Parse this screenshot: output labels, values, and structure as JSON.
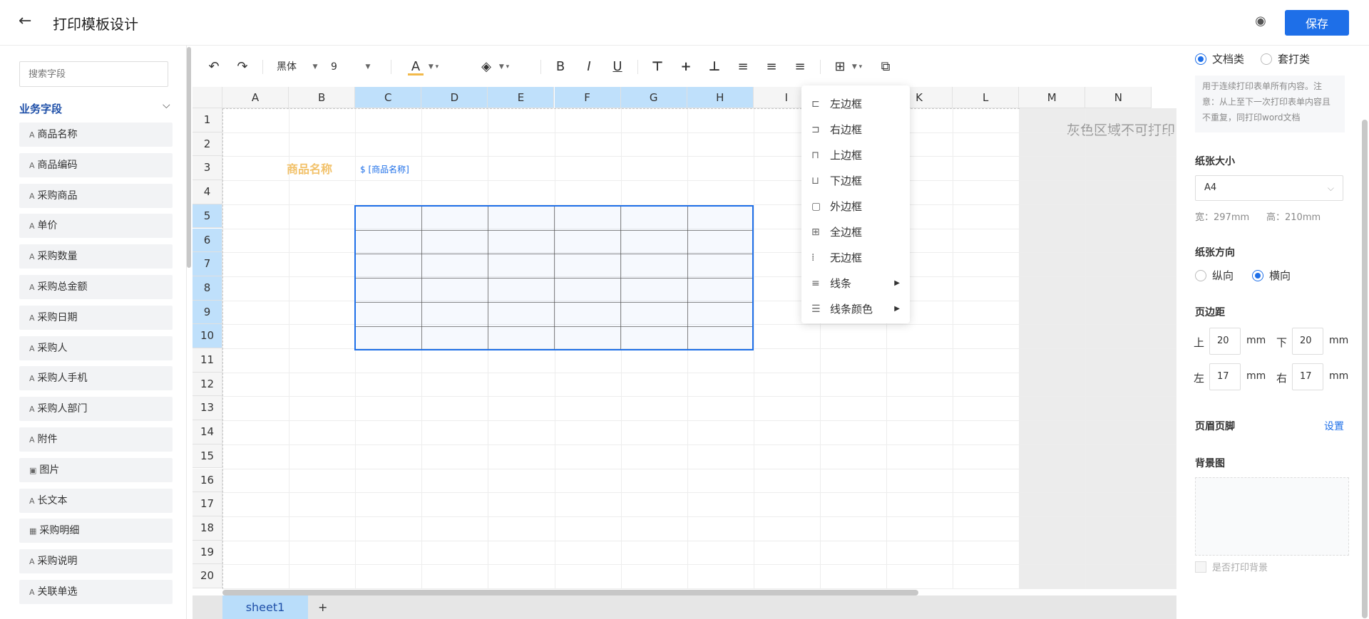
{
  "header": {
    "title": "打印模板设计",
    "save_label": "保存",
    "back_icon": "←",
    "eye_icon": "◉"
  },
  "left": {
    "search_placeholder": "搜索字段",
    "group_title": "业务字段",
    "fields": [
      {
        "icon": "A",
        "label": "商品名称"
      },
      {
        "icon": "A",
        "label": "商品编码"
      },
      {
        "icon": "A",
        "label": "采购商品"
      },
      {
        "icon": "A",
        "label": "单价"
      },
      {
        "icon": "A",
        "label": "采购数量"
      },
      {
        "icon": "A",
        "label": "采购总金额"
      },
      {
        "icon": "A",
        "label": "采购日期"
      },
      {
        "icon": "A",
        "label": "采购人"
      },
      {
        "icon": "A",
        "label": "采购人手机"
      },
      {
        "icon": "A",
        "label": "采购人部门"
      },
      {
        "icon": "A",
        "label": "附件"
      },
      {
        "icon": "▣",
        "label": "图片"
      },
      {
        "icon": "A",
        "label": "长文本"
      },
      {
        "icon": "▦",
        "label": "采购明细"
      },
      {
        "icon": "A",
        "label": "采购说明"
      },
      {
        "icon": "A",
        "label": "关联单选"
      }
    ]
  },
  "toolbar": {
    "font": "黑体",
    "size": "9"
  },
  "sheet": {
    "columns": [
      "A",
      "B",
      "C",
      "D",
      "E",
      "F",
      "G",
      "H",
      "I",
      "J",
      "K",
      "L",
      "M",
      "N"
    ],
    "rows": [
      "1",
      "2",
      "3",
      "4",
      "5",
      "6",
      "7",
      "8",
      "9",
      "10",
      "11",
      "12",
      "13",
      "14",
      "15",
      "16",
      "17",
      "18",
      "19",
      "20"
    ],
    "selected_columns": [
      "C",
      "D",
      "E",
      "F",
      "G",
      "H"
    ],
    "selected_rows": [
      "5",
      "6",
      "7",
      "8",
      "9",
      "10"
    ],
    "cell_label": "商品名称",
    "cell_var": "$ [商品名称]",
    "gray_note": "灰色区域不可打印",
    "tab": "sheet1",
    "tab_add": "+"
  },
  "border_menu": [
    {
      "icon": "⊏",
      "label": "左边框"
    },
    {
      "icon": "⊐",
      "label": "右边框"
    },
    {
      "icon": "⊓",
      "label": "上边框"
    },
    {
      "icon": "⊔",
      "label": "下边框"
    },
    {
      "icon": "▢",
      "label": "外边框"
    },
    {
      "icon": "⊞",
      "label": "全边框"
    },
    {
      "icon": "⁞",
      "label": "无边框"
    },
    {
      "icon": "≡",
      "label": "线条",
      "arrow": "▶"
    },
    {
      "icon": "☰",
      "label": "线条颜色",
      "arrow": "▶"
    }
  ],
  "right": {
    "type_doc": "文档类",
    "type_overlay": "套打类",
    "note": "用于连续打印表单所有内容。注意：从上至下一次打印表单内容且不重复，同打印word文档",
    "paper_size_title": "纸张大小",
    "paper_size": "A4",
    "width": "宽：297mm",
    "height": "高：210mm",
    "orientation_title": "纸张方向",
    "portrait": "纵向",
    "landscape": "横向",
    "margin_title": "页边距",
    "top_label": "上",
    "top": "20",
    "bottom_label": "下",
    "bottom": "20",
    "left_label": "左",
    "left": "17",
    "right_label": "右",
    "right": "17",
    "unit": "mm",
    "header_footer": "页眉页脚",
    "settings_link": "设置",
    "bg_title": "背景图",
    "print_bg": "是否打印背景"
  }
}
